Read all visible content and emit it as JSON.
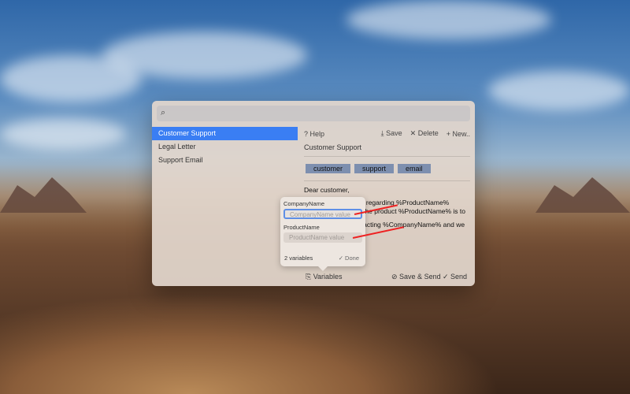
{
  "search": {
    "placeholder": ""
  },
  "sidebar": {
    "items": [
      {
        "label": "Customer Support"
      },
      {
        "label": "Legal Letter"
      },
      {
        "label": "Support Email"
      }
    ]
  },
  "toolbar": {
    "help": "? Help",
    "save": "⤓ Save",
    "delete": "✕ Delete",
    "new": "+ New.."
  },
  "snippet": {
    "title": "Customer Support",
    "tags": [
      "customer",
      "support",
      "email"
    ],
    "lines": [
      "Dear customer,",
      "ail regarding %ProductName%",
      "e the product %ProductName% is to",
      "ntacting %CompanyName% and we"
    ]
  },
  "popover": {
    "field1_label": "CompanyName",
    "field1_placeholder": "CompanyName value",
    "field2_label": "ProductName",
    "field2_placeholder": "ProductName value",
    "count": "2 variables",
    "done": "✓ Done"
  },
  "footer": {
    "variables": "Variables",
    "save_send": "Save & Send",
    "send": "✓ Send"
  },
  "colors": {
    "accent": "#3a7ef3",
    "tag": "#7d8faf"
  }
}
